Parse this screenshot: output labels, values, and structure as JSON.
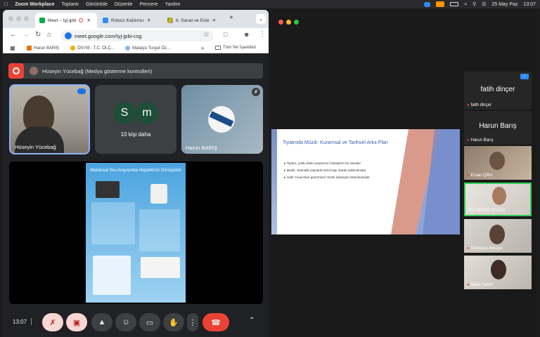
{
  "menubar": {
    "app": "Zoom Workplace",
    "menus": [
      "Toplantı",
      "Görüntüle",
      "Düzenle",
      "Pencere",
      "Yardım"
    ],
    "date": "25 May Paz",
    "time": "13:07"
  },
  "browser": {
    "tabs": [
      {
        "label": "Meet – tyj-jpbi",
        "active": true
      },
      {
        "label": "Rolsüz Katılımcı",
        "active": false
      },
      {
        "label": "6. Sanat ve Este",
        "active": false
      }
    ],
    "url": "meet.google.com/tyj-jpbi-csg",
    "bookmarks": [
      "Harun BARIŞ",
      "ÖSYM - T.C. ÖLÇ...",
      "Malatya Turgut Öz..."
    ],
    "bookmarks_more": "»",
    "all_bookmarks": "Tüm Yer İşaretleri"
  },
  "meet": {
    "presentation_bar": "Hüseyin Yücebağ (Medya gösterme kontrolleri)",
    "tiles": [
      {
        "name": "Hüseyin Yücebağ"
      },
      {
        "name": "10 kişi daha",
        "avatars": [
          "S",
          "m"
        ]
      },
      {
        "name": "Harun BARIŞ"
      }
    ],
    "poster_title": "Mekânsal Ses Arayışında Hoparlörün Dönüşümü",
    "clock": "13:07",
    "colors": {
      "red": "#ea4335",
      "bg": "#202124",
      "tile": "#3c4043"
    }
  },
  "zoom": {
    "slide_title": "Tiyatroda Müzik: Kuramsal ve Tarihsel Arka Plan",
    "slide_bullets": [
      "Tiyatro, çoklu ifade araçlarının birleştiren bir sanattır.",
      "Müzik, dramatik yapılarla temel taşı olarak kullanılmıştır.",
      "Antik Yunan'dan günümüze müzik sahneyle bütünleşmiştir."
    ],
    "participants": [
      {
        "big": "fatih dinçer",
        "small": "fatih dinçer"
      },
      {
        "big": "Harun Barış",
        "small": "Harun Barış"
      },
      {
        "small": "Ersan Çiftci"
      },
      {
        "small": "BİLGEHAN AYCAN"
      },
      {
        "small": "Sümeyra Akkaya"
      },
      {
        "small": "Seda Sahin"
      }
    ]
  }
}
